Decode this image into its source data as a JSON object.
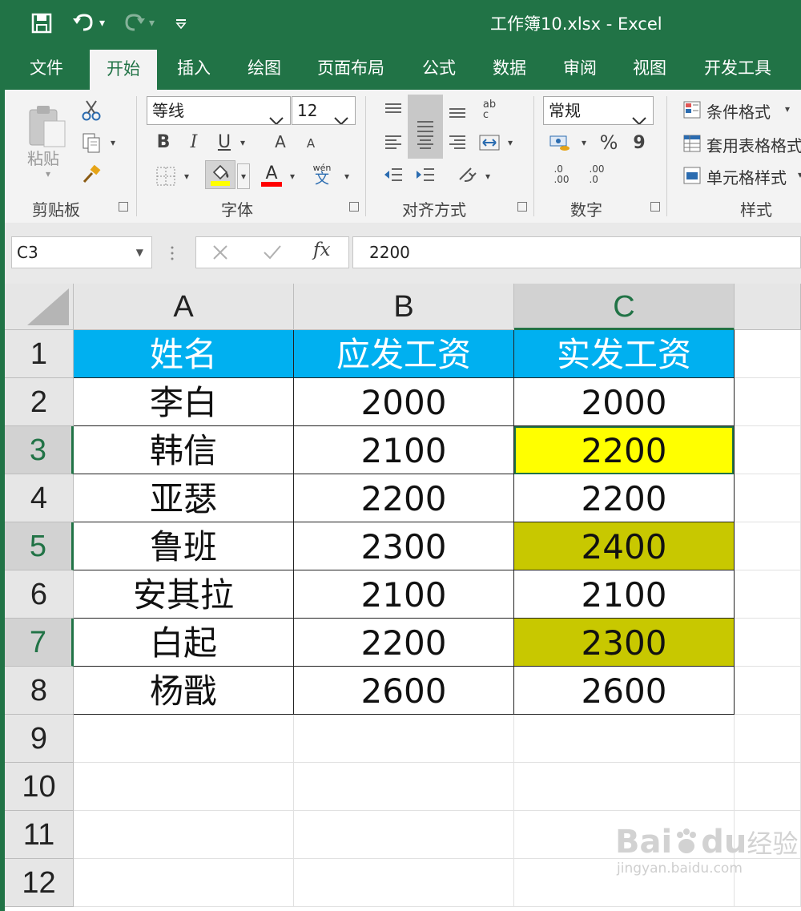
{
  "window": {
    "title": "工作簿10.xlsx  -  Excel"
  },
  "tabs": [
    {
      "label": "文件",
      "active": false
    },
    {
      "label": "开始",
      "active": true
    },
    {
      "label": "插入",
      "active": false
    },
    {
      "label": "绘图",
      "active": false
    },
    {
      "label": "页面布局",
      "active": false
    },
    {
      "label": "公式",
      "active": false
    },
    {
      "label": "数据",
      "active": false
    },
    {
      "label": "审阅",
      "active": false
    },
    {
      "label": "视图",
      "active": false
    },
    {
      "label": "开发工具",
      "active": false
    }
  ],
  "ribbon": {
    "clipboard": {
      "paste_label": "粘贴",
      "group_label": "剪贴板"
    },
    "font": {
      "font_name": "等线",
      "font_size": "12",
      "group_label": "字体",
      "bold": "B",
      "italic": "I",
      "underline": "U",
      "grow": "A",
      "shrink": "A",
      "font_color_glyph": "A",
      "phonetic_top": "wén",
      "phonetic_bottom": "文",
      "fill_color": "#ffff00",
      "font_color": "#ff0000"
    },
    "alignment": {
      "group_label": "对齐方式"
    },
    "number": {
      "format": "常规",
      "group_label": "数字",
      "percent": "%",
      "comma": "9",
      "inc_decimal": ".0\n.00",
      "dec_decimal": ".00\n.0"
    },
    "styles": {
      "group_label": "样式",
      "conditional": "条件格式",
      "table": "套用表格格式",
      "cell_styles": "单元格样式"
    }
  },
  "formula_bar": {
    "name_box": "C3",
    "formula": "2200",
    "fx": "fx"
  },
  "sheet": {
    "columns": [
      "A",
      "B",
      "C"
    ],
    "selected_column": "C",
    "selected_cell": "C3",
    "header_fill": "#00b0f0",
    "rows": [
      {
        "num": "1",
        "cells": [
          "姓名",
          "应发工资",
          "实发工资"
        ],
        "fills": [
          "#00b0f0",
          "#00b0f0",
          "#00b0f0"
        ],
        "header": true
      },
      {
        "num": "2",
        "cells": [
          "李白",
          "2000",
          "2000"
        ],
        "fills": [
          "",
          "",
          ""
        ]
      },
      {
        "num": "3",
        "cells": [
          "韩信",
          "2100",
          "2200"
        ],
        "fills": [
          "",
          "",
          "#ffff00"
        ],
        "selected": true
      },
      {
        "num": "4",
        "cells": [
          "亚瑟",
          "2200",
          "2200"
        ],
        "fills": [
          "",
          "",
          ""
        ]
      },
      {
        "num": "5",
        "cells": [
          "鲁班",
          "2300",
          "2400"
        ],
        "fills": [
          "",
          "",
          "#c8c800"
        ],
        "selected": true
      },
      {
        "num": "6",
        "cells": [
          "安其拉",
          "2100",
          "2100"
        ],
        "fills": [
          "",
          "",
          ""
        ]
      },
      {
        "num": "7",
        "cells": [
          "白起",
          "2200",
          "2300"
        ],
        "fills": [
          "",
          "",
          "#c8c800"
        ],
        "selected": true
      },
      {
        "num": "8",
        "cells": [
          "杨戬",
          "2600",
          "2600"
        ],
        "fills": [
          "",
          "",
          ""
        ]
      },
      {
        "num": "9",
        "cells": [
          "",
          "",
          ""
        ],
        "fills": [
          "",
          "",
          ""
        ],
        "empty": true
      },
      {
        "num": "10",
        "cells": [
          "",
          "",
          ""
        ],
        "fills": [
          "",
          "",
          ""
        ],
        "empty": true
      },
      {
        "num": "11",
        "cells": [
          "",
          "",
          ""
        ],
        "fills": [
          "",
          "",
          ""
        ],
        "empty": true
      },
      {
        "num": "12",
        "cells": [
          "",
          "",
          ""
        ],
        "fills": [
          "",
          "",
          ""
        ],
        "empty": true
      }
    ]
  },
  "watermark": {
    "brand": "Bai",
    "brand2": "du",
    "brand_cn": "经验",
    "url": "jingyan.baidu.com"
  }
}
